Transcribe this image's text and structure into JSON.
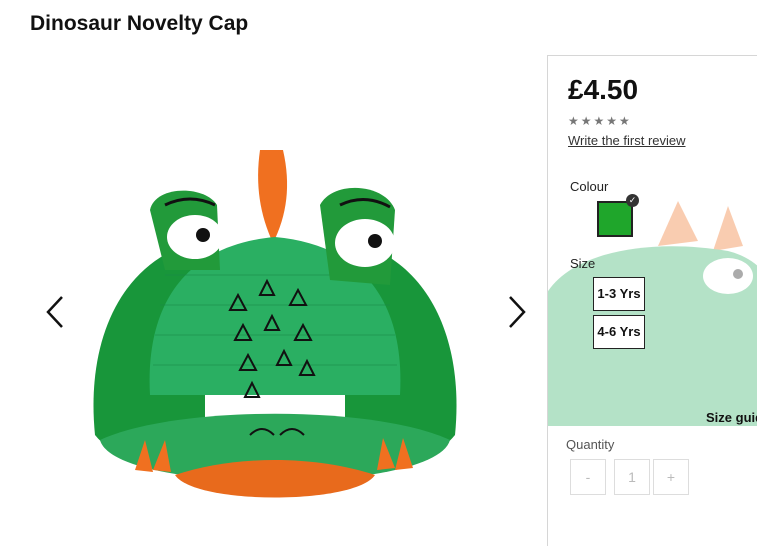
{
  "product": {
    "title": "Dinosaur Novelty Cap"
  },
  "gallery": {
    "image": "dinosaur-cap-photo",
    "prev_icon": "chevron-left-icon",
    "next_icon": "chevron-right-icon"
  },
  "purchase": {
    "price": "£4.50",
    "rating_stars": "★★★★★",
    "rating_value": 0,
    "review_link": "Write the first review",
    "colour_label": "Colour",
    "selected_colour": "#1fa62b",
    "size_label": "Size",
    "sizes": [
      "1-3 Yrs",
      "4-6 Yrs"
    ],
    "size_guide": "Size guide",
    "quantity_label": "Quantity",
    "quantity_minus": "-",
    "quantity_value": "1",
    "quantity_plus": "+"
  },
  "colors": {
    "cap_green": "#1e9a3c",
    "mesh_green": "#2db365",
    "horn_orange": "#f07020",
    "swatch_green": "#1fa62b"
  }
}
